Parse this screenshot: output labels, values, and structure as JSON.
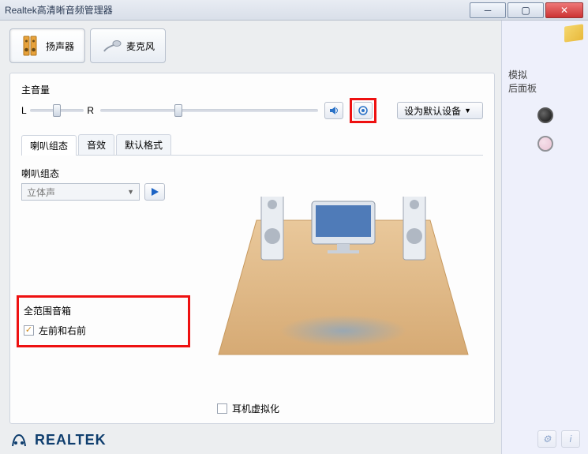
{
  "window": {
    "title": "Realtek高清晰音频管理器"
  },
  "device_tabs": {
    "speaker": "扬声器",
    "mic": "麦克风"
  },
  "main_volume": {
    "label": "主音量",
    "left": "L",
    "right": "R",
    "balance_pct": 50,
    "volume_pct": 36,
    "default_btn": "设为默认设备"
  },
  "sub_tabs": [
    "喇叭组态",
    "音效",
    "默认格式"
  ],
  "speaker_config": {
    "title": "喇叭组态",
    "selected": "立体声"
  },
  "full_range": {
    "title": "全范围音箱",
    "option": "左前和右前",
    "checked": true
  },
  "headphone_virt": {
    "label": "耳机虚拟化",
    "checked": false
  },
  "side": {
    "label1": "模拟",
    "label2": "后面板"
  },
  "brand": "REALTEK"
}
